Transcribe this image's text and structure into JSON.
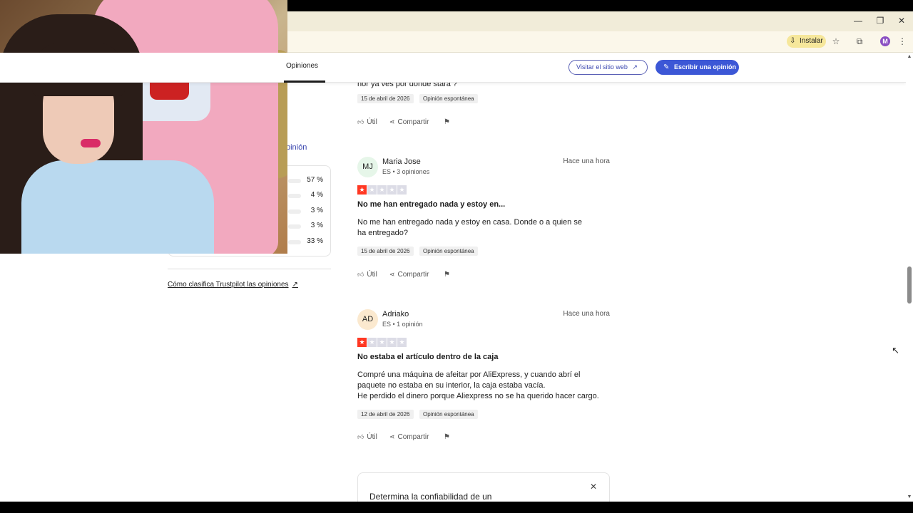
{
  "browser": {
    "install_label": "Instalar",
    "profile_initial": "M"
  },
  "header": {
    "tab_opiniones": "Opiniones",
    "visit_label": "Visitar el sitio web",
    "write_label": "Escribir una opinión"
  },
  "left": {
    "opinion_link": "pinión",
    "distribution": [
      "57 %",
      "4 %",
      "3 %",
      "3 %",
      "33 %"
    ],
    "trust_link": "Cómo clasifica Trustpilot las opiniones"
  },
  "reviews": {
    "cut_text": "hor ya ves por donde stará ?",
    "first": {
      "date": "15 de abril de 2026",
      "tag": "Opinión espontánea"
    },
    "items": [
      {
        "initials": "MJ",
        "avatar_color": "#e6f6e9",
        "name": "Maria Jose",
        "meta": "ES • 3 opiniones",
        "time": "Hace una hora",
        "rating": 1,
        "title": "No me han entregado nada y estoy en...",
        "body": [
          "No me han entregado nada y estoy en casa. Donde o a quien se",
          "ha entregado?"
        ],
        "date": "15 de abril de 2026",
        "tag": "Opinión espontánea"
      },
      {
        "initials": "AD",
        "avatar_color": "#fbe9cf",
        "name": "Adriako",
        "meta": "ES • 1 opinión",
        "time": "Hace una hora",
        "rating": 1,
        "title": "No estaba el artículo dentro de la caja",
        "body": [
          "Compré una máquina de afeitar por AliExpress, y cuando abrí el",
          "paquete no estaba en su interior, la caja estaba vacía.",
          "He perdido el dinero porque Aliexpress no se ha querido hacer cargo."
        ],
        "date": "12 de abril de 2026",
        "tag": "Opinión espontánea"
      }
    ],
    "actions": {
      "useful": "Útil",
      "share": "Compartir"
    }
  },
  "card": {
    "title": "Determina la confiabilidad de un"
  },
  "icons": {
    "minimize": "minimize-icon",
    "restore": "restore-icon",
    "close": "close-icon",
    "star": "star-icon",
    "extensions": "puzzle-icon",
    "menu": "kebab-menu-icon"
  },
  "colors": {
    "brand_blue": "#3c57d6",
    "star_red": "#ff3722",
    "star_empty": "#dcdce6"
  }
}
